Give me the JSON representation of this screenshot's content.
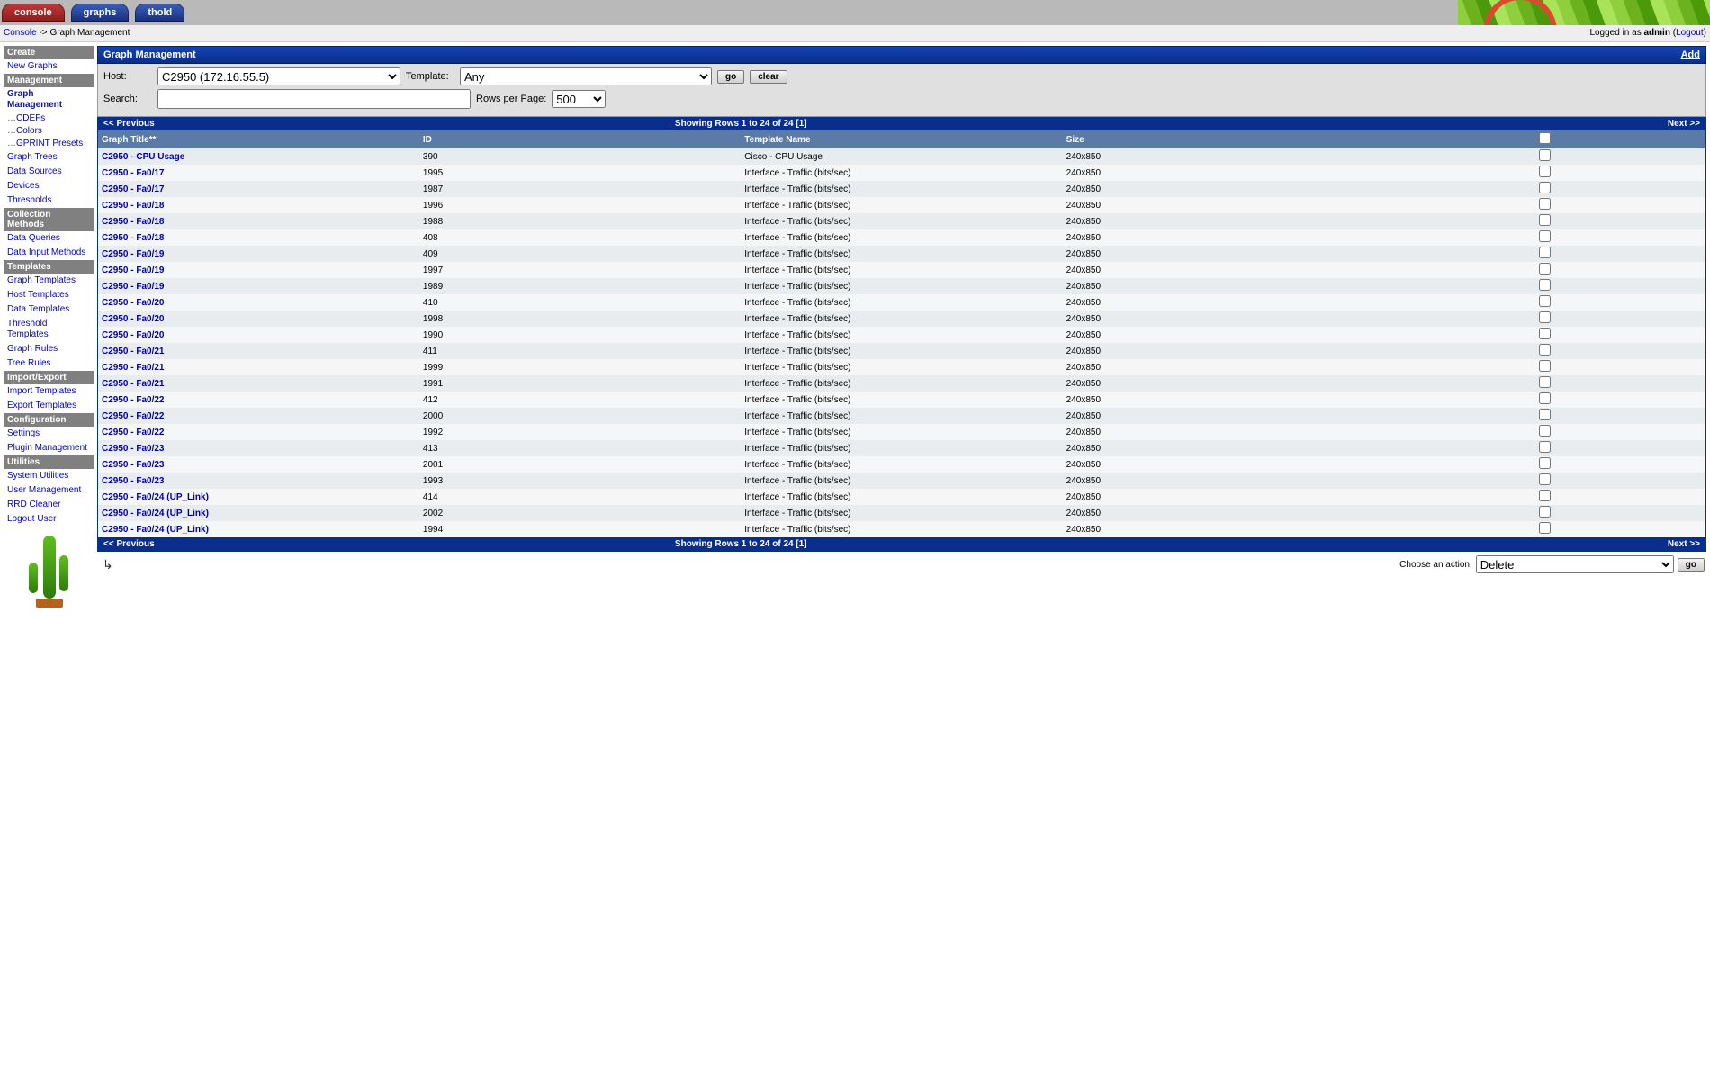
{
  "tabs": {
    "console": "console",
    "graphs": "graphs",
    "thold": "thold"
  },
  "breadcrumb": {
    "root": "Console",
    "sep": " -> ",
    "current": "Graph Management"
  },
  "login": {
    "prefix": "Logged in as ",
    "user": "admin",
    "logout": "Logout"
  },
  "sidebar": {
    "create": {
      "header": "Create",
      "new_graphs": "New Graphs"
    },
    "management": {
      "header": "Management",
      "graph_management": "Graph Management",
      "cdefs": "CDEFs",
      "colors": "Colors",
      "gprint": "GPRINT Presets",
      "graph_trees": "Graph Trees",
      "data_sources": "Data Sources",
      "devices": "Devices",
      "thresholds": "Thresholds"
    },
    "collection": {
      "header": "Collection Methods",
      "data_queries": "Data Queries",
      "data_input": "Data Input Methods"
    },
    "templates": {
      "header": "Templates",
      "graph_tpl": "Graph Templates",
      "host_tpl": "Host Templates",
      "data_tpl": "Data Templates",
      "thold_tpl": "Threshold Templates",
      "graph_rules": "Graph Rules",
      "tree_rules": "Tree Rules"
    },
    "impexp": {
      "header": "Import/Export",
      "import_tpl": "Import Templates",
      "export_tpl": "Export Templates"
    },
    "config": {
      "header": "Configuration",
      "settings": "Settings",
      "plugin": "Plugin Management"
    },
    "utilities": {
      "header": "Utilities",
      "sysutil": "System Utilities",
      "usermgmt": "User Management",
      "rrdcleaner": "RRD Cleaner",
      "logout": "Logout User"
    }
  },
  "panel": {
    "title": "Graph Management",
    "add": "Add"
  },
  "filter": {
    "host_label": "Host:",
    "host_value": "C2950 (172.16.55.5)",
    "tmpl_label": "Template:",
    "tmpl_value": "Any",
    "go": "go",
    "clear": "clear",
    "search_label": "Search:",
    "search_value": "",
    "rpp_label": "Rows per Page:",
    "rpp_value": "500"
  },
  "nav": {
    "prev": "<< Previous",
    "showing": "Showing Rows 1 to 24 of 24 [",
    "page": "1",
    "close": "]",
    "next": "Next >>"
  },
  "cols": {
    "title": "Graph Title**",
    "id": "ID",
    "tn": "Template Name",
    "size": "Size"
  },
  "rows": [
    {
      "title": "C2950 - CPU Usage",
      "id": "390",
      "tn": "Cisco - CPU Usage",
      "size": "240x850"
    },
    {
      "title": "C2950 - Fa0/17",
      "id": "1995",
      "tn": "Interface - Traffic (bits/sec)",
      "size": "240x850"
    },
    {
      "title": "C2950 - Fa0/17",
      "id": "1987",
      "tn": "Interface - Traffic (bits/sec)",
      "size": "240x850"
    },
    {
      "title": "C2950 - Fa0/18",
      "id": "1996",
      "tn": "Interface - Traffic (bits/sec)",
      "size": "240x850"
    },
    {
      "title": "C2950 - Fa0/18",
      "id": "1988",
      "tn": "Interface - Traffic (bits/sec)",
      "size": "240x850"
    },
    {
      "title": "C2950 - Fa0/18",
      "id": "408",
      "tn": "Interface - Traffic (bits/sec)",
      "size": "240x850"
    },
    {
      "title": "C2950 - Fa0/19",
      "id": "409",
      "tn": "Interface - Traffic (bits/sec)",
      "size": "240x850"
    },
    {
      "title": "C2950 - Fa0/19",
      "id": "1997",
      "tn": "Interface - Traffic (bits/sec)",
      "size": "240x850"
    },
    {
      "title": "C2950 - Fa0/19",
      "id": "1989",
      "tn": "Interface - Traffic (bits/sec)",
      "size": "240x850"
    },
    {
      "title": "C2950 - Fa0/20",
      "id": "410",
      "tn": "Interface - Traffic (bits/sec)",
      "size": "240x850"
    },
    {
      "title": "C2950 - Fa0/20",
      "id": "1998",
      "tn": "Interface - Traffic (bits/sec)",
      "size": "240x850"
    },
    {
      "title": "C2950 - Fa0/20",
      "id": "1990",
      "tn": "Interface - Traffic (bits/sec)",
      "size": "240x850"
    },
    {
      "title": "C2950 - Fa0/21",
      "id": "411",
      "tn": "Interface - Traffic (bits/sec)",
      "size": "240x850"
    },
    {
      "title": "C2950 - Fa0/21",
      "id": "1999",
      "tn": "Interface - Traffic (bits/sec)",
      "size": "240x850"
    },
    {
      "title": "C2950 - Fa0/21",
      "id": "1991",
      "tn": "Interface - Traffic (bits/sec)",
      "size": "240x850"
    },
    {
      "title": "C2950 - Fa0/22",
      "id": "412",
      "tn": "Interface - Traffic (bits/sec)",
      "size": "240x850"
    },
    {
      "title": "C2950 - Fa0/22",
      "id": "2000",
      "tn": "Interface - Traffic (bits/sec)",
      "size": "240x850"
    },
    {
      "title": "C2950 - Fa0/22",
      "id": "1992",
      "tn": "Interface - Traffic (bits/sec)",
      "size": "240x850"
    },
    {
      "title": "C2950 - Fa0/23",
      "id": "413",
      "tn": "Interface - Traffic (bits/sec)",
      "size": "240x850"
    },
    {
      "title": "C2950 - Fa0/23",
      "id": "2001",
      "tn": "Interface - Traffic (bits/sec)",
      "size": "240x850"
    },
    {
      "title": "C2950 - Fa0/23",
      "id": "1993",
      "tn": "Interface - Traffic (bits/sec)",
      "size": "240x850"
    },
    {
      "title": "C2950 - Fa0/24 (UP_Link)",
      "id": "414",
      "tn": "Interface - Traffic (bits/sec)",
      "size": "240x850"
    },
    {
      "title": "C2950 - Fa0/24 (UP_Link)",
      "id": "2002",
      "tn": "Interface - Traffic (bits/sec)",
      "size": "240x850"
    },
    {
      "title": "C2950 - Fa0/24 (UP_Link)",
      "id": "1994",
      "tn": "Interface - Traffic (bits/sec)",
      "size": "240x850"
    }
  ],
  "action": {
    "label": "Choose an action:",
    "value": "Delete",
    "go": "go"
  }
}
